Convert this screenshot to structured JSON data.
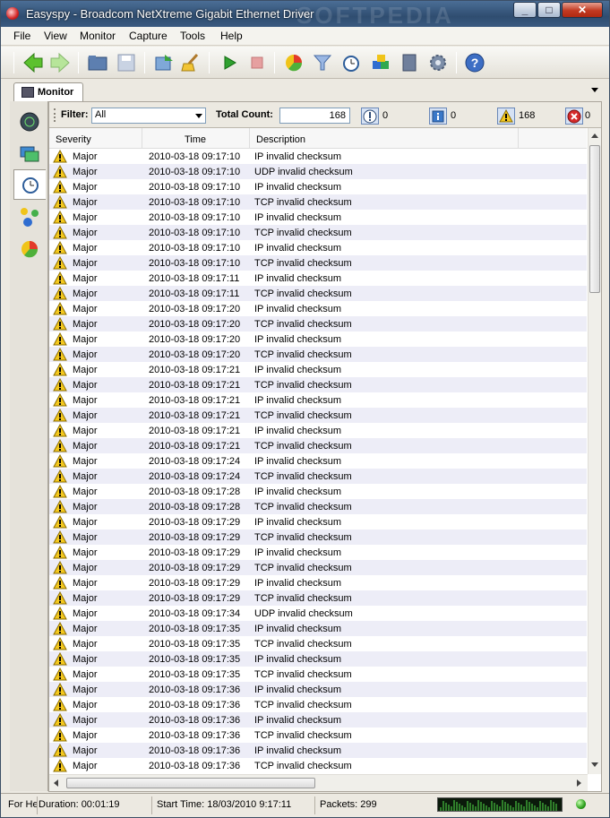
{
  "window": {
    "title": "Easyspy - Broadcom NetXtreme Gigabit Ethernet Driver",
    "watermark": "SOFTPEDIA"
  },
  "menu": [
    "File",
    "View",
    "Monitor",
    "Capture",
    "Tools",
    "Help"
  ],
  "tab": {
    "label": "Monitor"
  },
  "filter": {
    "label": "Filter:",
    "value": "All"
  },
  "total_count": {
    "label": "Total Count:",
    "value": "168"
  },
  "counters": {
    "exclamation": "0",
    "info": "0",
    "warning": "168",
    "error": "0"
  },
  "table": {
    "headers": [
      "Severity",
      "Time",
      "Description"
    ],
    "rows": [
      [
        "Major",
        "2010-03-18 09:17:10",
        "IP invalid checksum"
      ],
      [
        "Major",
        "2010-03-18 09:17:10",
        "UDP invalid checksum"
      ],
      [
        "Major",
        "2010-03-18 09:17:10",
        "IP invalid checksum"
      ],
      [
        "Major",
        "2010-03-18 09:17:10",
        "TCP invalid checksum"
      ],
      [
        "Major",
        "2010-03-18 09:17:10",
        "IP invalid checksum"
      ],
      [
        "Major",
        "2010-03-18 09:17:10",
        "TCP invalid checksum"
      ],
      [
        "Major",
        "2010-03-18 09:17:10",
        "IP invalid checksum"
      ],
      [
        "Major",
        "2010-03-18 09:17:10",
        "TCP invalid checksum"
      ],
      [
        "Major",
        "2010-03-18 09:17:11",
        "IP invalid checksum"
      ],
      [
        "Major",
        "2010-03-18 09:17:11",
        "TCP invalid checksum"
      ],
      [
        "Major",
        "2010-03-18 09:17:20",
        "IP invalid checksum"
      ],
      [
        "Major",
        "2010-03-18 09:17:20",
        "TCP invalid checksum"
      ],
      [
        "Major",
        "2010-03-18 09:17:20",
        "IP invalid checksum"
      ],
      [
        "Major",
        "2010-03-18 09:17:20",
        "TCP invalid checksum"
      ],
      [
        "Major",
        "2010-03-18 09:17:21",
        "IP invalid checksum"
      ],
      [
        "Major",
        "2010-03-18 09:17:21",
        "TCP invalid checksum"
      ],
      [
        "Major",
        "2010-03-18 09:17:21",
        "IP invalid checksum"
      ],
      [
        "Major",
        "2010-03-18 09:17:21",
        "TCP invalid checksum"
      ],
      [
        "Major",
        "2010-03-18 09:17:21",
        "IP invalid checksum"
      ],
      [
        "Major",
        "2010-03-18 09:17:21",
        "TCP invalid checksum"
      ],
      [
        "Major",
        "2010-03-18 09:17:24",
        "IP invalid checksum"
      ],
      [
        "Major",
        "2010-03-18 09:17:24",
        "TCP invalid checksum"
      ],
      [
        "Major",
        "2010-03-18 09:17:28",
        "IP invalid checksum"
      ],
      [
        "Major",
        "2010-03-18 09:17:28",
        "TCP invalid checksum"
      ],
      [
        "Major",
        "2010-03-18 09:17:29",
        "IP invalid checksum"
      ],
      [
        "Major",
        "2010-03-18 09:17:29",
        "TCP invalid checksum"
      ],
      [
        "Major",
        "2010-03-18 09:17:29",
        "IP invalid checksum"
      ],
      [
        "Major",
        "2010-03-18 09:17:29",
        "TCP invalid checksum"
      ],
      [
        "Major",
        "2010-03-18 09:17:29",
        "IP invalid checksum"
      ],
      [
        "Major",
        "2010-03-18 09:17:29",
        "TCP invalid checksum"
      ],
      [
        "Major",
        "2010-03-18 09:17:34",
        "UDP invalid checksum"
      ],
      [
        "Major",
        "2010-03-18 09:17:35",
        "IP invalid checksum"
      ],
      [
        "Major",
        "2010-03-18 09:17:35",
        "TCP invalid checksum"
      ],
      [
        "Major",
        "2010-03-18 09:17:35",
        "IP invalid checksum"
      ],
      [
        "Major",
        "2010-03-18 09:17:35",
        "TCP invalid checksum"
      ],
      [
        "Major",
        "2010-03-18 09:17:36",
        "IP invalid checksum"
      ],
      [
        "Major",
        "2010-03-18 09:17:36",
        "TCP invalid checksum"
      ],
      [
        "Major",
        "2010-03-18 09:17:36",
        "IP invalid checksum"
      ],
      [
        "Major",
        "2010-03-18 09:17:36",
        "TCP invalid checksum"
      ],
      [
        "Major",
        "2010-03-18 09:17:36",
        "IP invalid checksum"
      ],
      [
        "Major",
        "2010-03-18 09:17:36",
        "TCP invalid checksum"
      ]
    ]
  },
  "status": {
    "help": "For He",
    "duration": "Duration: 00:01:19",
    "start_time": "Start Time: 18/03/2010 9:17:11",
    "packets": "Packets: 299"
  }
}
